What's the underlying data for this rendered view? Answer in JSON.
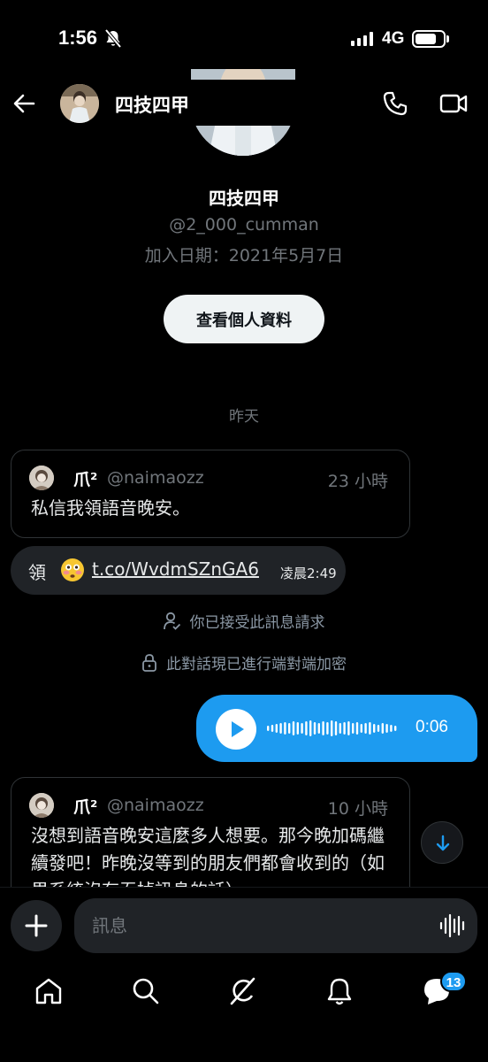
{
  "status_bar": {
    "time": "1:56",
    "network": "4G",
    "icons": [
      "bell-off-icon",
      "signal-icon",
      "battery-icon"
    ]
  },
  "header": {
    "name": "四技四甲",
    "icons": [
      "back-arrow-icon",
      "phone-icon",
      "video-icon"
    ]
  },
  "profile": {
    "name": "四技四甲",
    "handle": "@2_000_cumman",
    "joined": "加入日期：2021年5月7日",
    "view_profile_label": "查看個人資料"
  },
  "conversation": {
    "date_separator": "昨天",
    "messages": [
      {
        "type": "shared_post",
        "author_name": "爪²",
        "author_handle": "@naimaozz",
        "time_ago": "23 小時",
        "text": "私信我領語音晚安。"
      },
      {
        "type": "text",
        "prefix": "領",
        "emoji": "flushed-face-emoji",
        "link": "t.co/WvdmSZnGA6",
        "time": "凌晨2:49"
      },
      {
        "type": "system",
        "icon": "person-check-icon",
        "text": "你已接受此訊息請求"
      },
      {
        "type": "system",
        "icon": "lock-icon",
        "text": "此對話現已進行端對端加密"
      },
      {
        "type": "voice",
        "sender": "me",
        "duration": "0:06",
        "accent_color": "#1d9bf0"
      },
      {
        "type": "shared_post",
        "author_name": "爪²",
        "author_handle": "@naimaozz",
        "time_ago": "10 小時",
        "text": "沒想到語音晚安這麼多人想要。那今晚加碼繼續發吧！昨晚沒等到的朋友們都會收到的（如果系統沒有吞掉訊息的話）。"
      }
    ]
  },
  "composer": {
    "placeholder": "訊息",
    "icons": [
      "plus-icon",
      "voice-waveform-icon"
    ]
  },
  "tabbar": {
    "tabs": [
      "home",
      "search",
      "grok",
      "notifications",
      "messages"
    ],
    "messages_badge": "13"
  }
}
